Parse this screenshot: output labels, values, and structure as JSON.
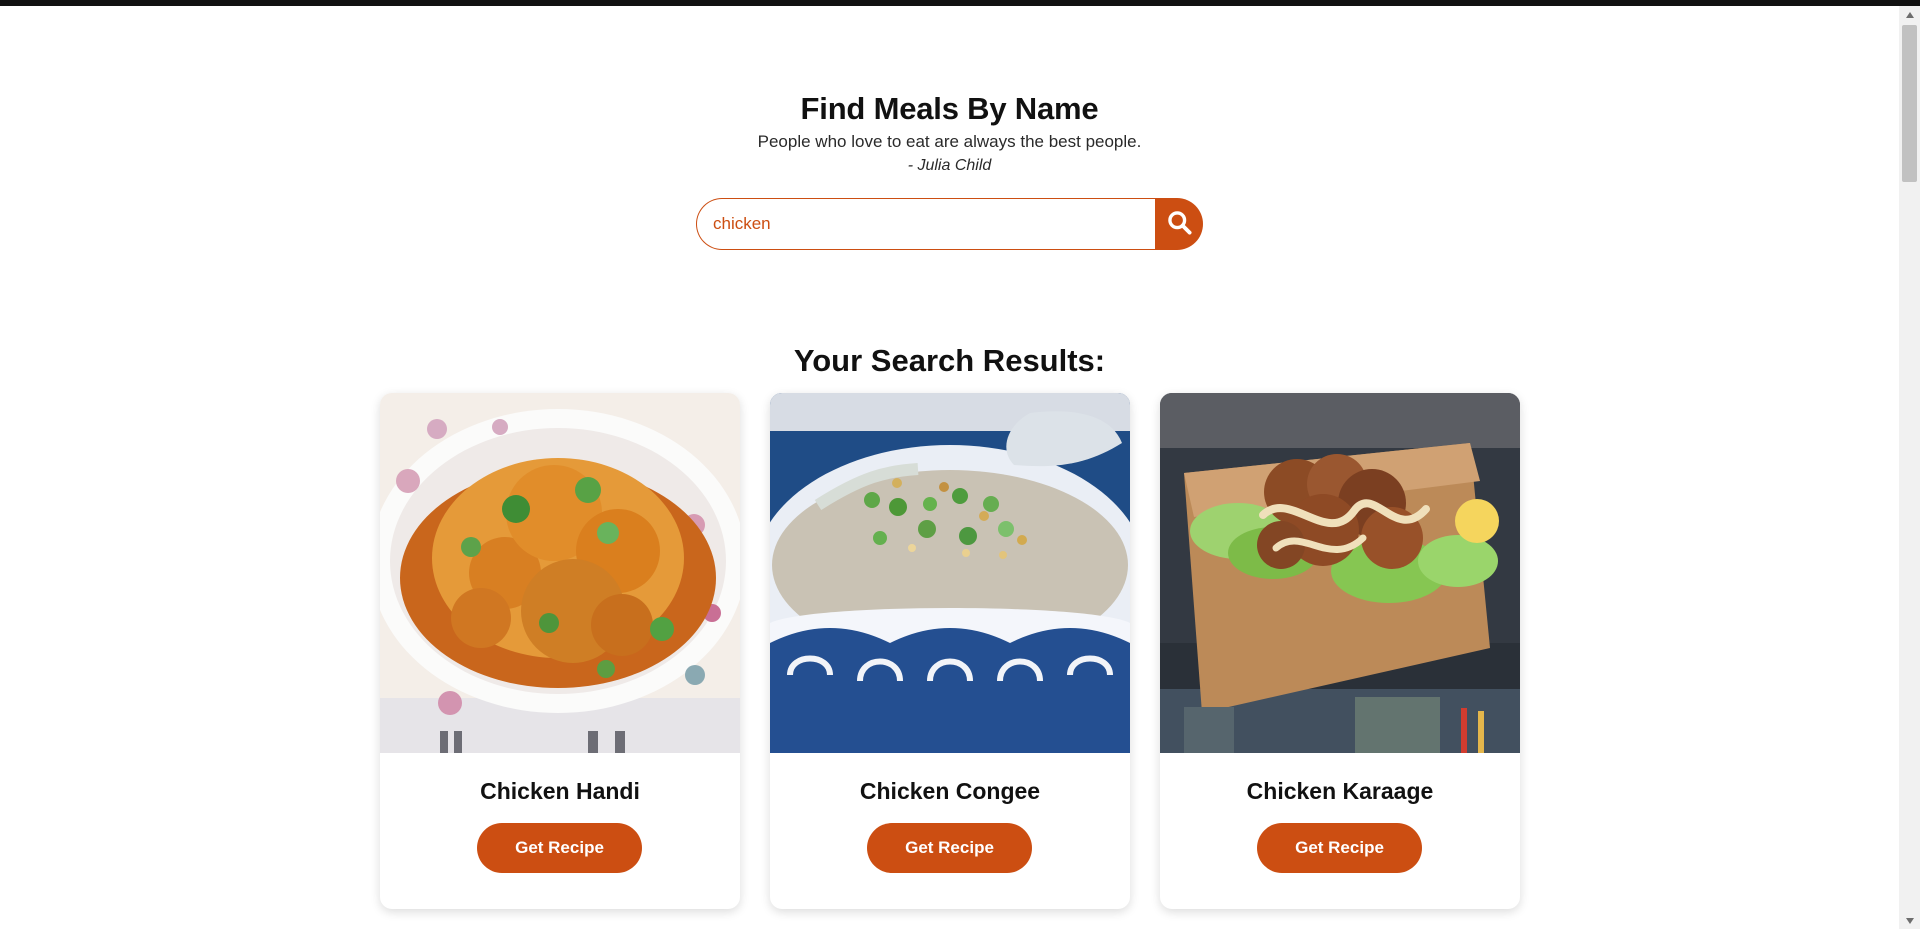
{
  "colors": {
    "accent": "#cc4e12",
    "top_bar": "#111111",
    "heading": "#111111",
    "card_background": "#ffffff"
  },
  "header": {
    "title": "Find Meals By Name",
    "quote": "People who love to eat are always the best people.",
    "author": "- Julia Child"
  },
  "search": {
    "value": "chicken",
    "button_icon": "search-icon"
  },
  "results": {
    "title": "Your Search Results:",
    "cards": [
      {
        "name": "Chicken Handi",
        "button_label": "Get Recipe",
        "image_icon": "chicken-handi-image"
      },
      {
        "name": "Chicken Congee",
        "button_label": "Get Recipe",
        "image_icon": "chicken-congee-image"
      },
      {
        "name": "Chicken Karaage",
        "button_label": "Get Recipe",
        "image_icon": "chicken-karaage-image"
      }
    ]
  }
}
